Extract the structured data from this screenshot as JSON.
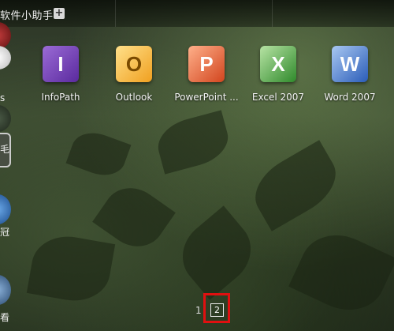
{
  "topbar": {
    "title": "软件小助手",
    "add_label": "+"
  },
  "dock": {
    "labels": [
      "s",
      "毛",
      "冠",
      "看"
    ]
  },
  "apps": [
    {
      "name": "InfoPath",
      "glyph": "I"
    },
    {
      "name": "Outlook",
      "glyph": "O"
    },
    {
      "name": "PowerPoint ...",
      "glyph": "P"
    },
    {
      "name": "Excel 2007",
      "glyph": "X"
    },
    {
      "name": "Word 2007",
      "glyph": "W"
    }
  ],
  "pager": {
    "page1": "1",
    "page2": "2"
  },
  "colors": {
    "highlight": "#e01010"
  }
}
